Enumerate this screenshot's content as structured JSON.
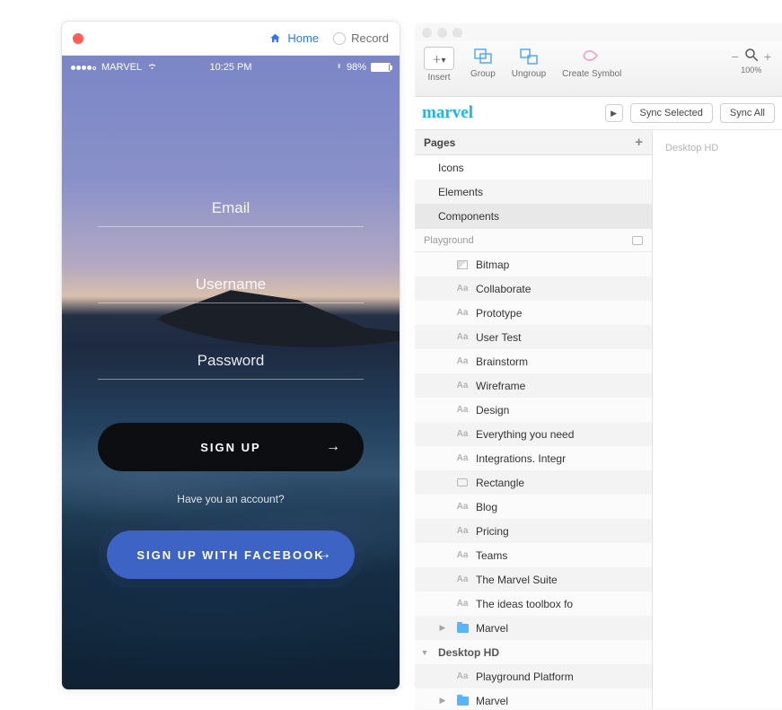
{
  "phone": {
    "titlebar": {
      "home": "Home",
      "record": "Record"
    },
    "statusbar": {
      "carrier": "MARVEL",
      "time": "10:25 PM",
      "battery": "98%"
    },
    "fields": {
      "email_ph": "Email",
      "username_ph": "Username",
      "password_ph": "Password"
    },
    "signup": "SIGN UP",
    "have_account": "Have you an account?",
    "signup_fb": "SIGN UP WITH FACEBOOK"
  },
  "sketch": {
    "toolbar": {
      "insert": "Insert",
      "group": "Group",
      "ungroup": "Ungroup",
      "create_symbol": "Create Symbol",
      "zoom_pct": "100%"
    },
    "plugin": {
      "sync_selected": "Sync Selected",
      "sync_all": "Sync All"
    },
    "pages_header": "Pages",
    "pages": [
      "Icons",
      "Elements",
      "Components"
    ],
    "section": "Playground",
    "layers": [
      {
        "icon": "bmp",
        "label": "Bitmap"
      },
      {
        "icon": "aa",
        "label": "Collaborate"
      },
      {
        "icon": "aa",
        "label": "Prototype"
      },
      {
        "icon": "aa",
        "label": "User Test"
      },
      {
        "icon": "aa",
        "label": "Brainstorm"
      },
      {
        "icon": "aa",
        "label": "Wireframe"
      },
      {
        "icon": "aa",
        "label": "Design"
      },
      {
        "icon": "aa",
        "label": "Everything you need"
      },
      {
        "icon": "aa",
        "label": "Integrations. Integr"
      },
      {
        "icon": "rect",
        "label": "Rectangle"
      },
      {
        "icon": "aa",
        "label": "Blog"
      },
      {
        "icon": "aa",
        "label": "Pricing"
      },
      {
        "icon": "aa",
        "label": "Teams"
      },
      {
        "icon": "aa",
        "label": "The Marvel Suite"
      },
      {
        "icon": "aa",
        "label": "The ideas toolbox fo"
      },
      {
        "icon": "folder",
        "label": "Marvel",
        "disc": "right"
      }
    ],
    "artboard_group": "Desktop HD",
    "artboard_layers": [
      {
        "icon": "aa",
        "label": "Playground Platform"
      },
      {
        "icon": "folder",
        "label": "Marvel",
        "disc": "right"
      }
    ],
    "canvas_label": "Desktop HD"
  }
}
